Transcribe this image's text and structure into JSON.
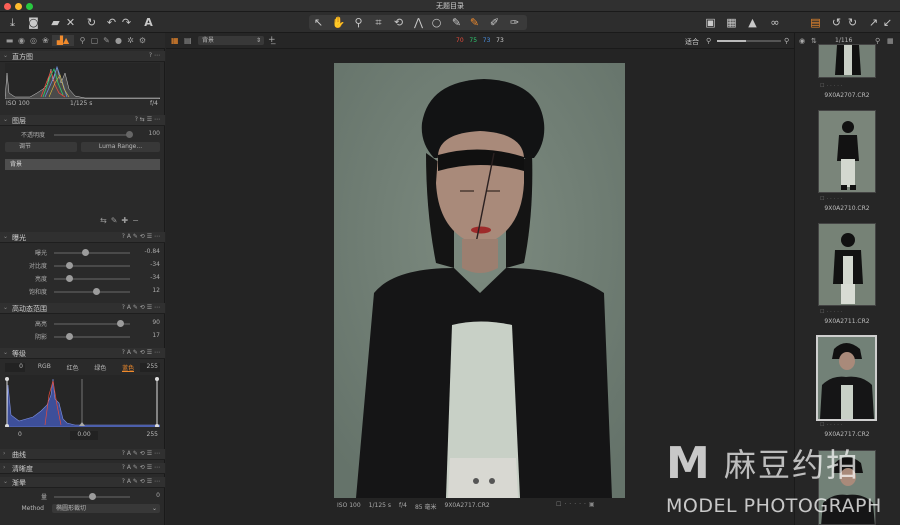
{
  "window": {
    "title": "无题目录"
  },
  "toolbar": {
    "left_icons": [
      "import-icon",
      "camera-icon",
      "export-icon",
      "delete-icon",
      "refresh-icon",
      "undo-icon",
      "redo-icon",
      "text-icon"
    ],
    "center_icons": [
      "select-tool-icon",
      "pan-tool-icon",
      "loupe-tool-icon",
      "crop-tool-icon",
      "rotate-tool-icon",
      "keystone-tool-icon",
      "spot-tool-icon",
      "brush-tool-icon",
      "brush-active-tool-icon",
      "eraser-tool-icon",
      "gradient-tool-icon"
    ],
    "right_icons": [
      "edit-icon",
      "grid-icon",
      "warning-icon",
      "glasses-icon",
      "copy-icon",
      "rotate-left-icon",
      "rotate-right-icon",
      "expand-icon",
      "collapse-icon"
    ]
  },
  "viewer_header": {
    "layer_select": "背景",
    "readout": [
      "70",
      "75",
      "73",
      "73"
    ],
    "readout_colors": [
      "#e74c3c",
      "#2ecc71",
      "#4a90e2",
      "#cfcfcf"
    ],
    "fit_label": "适合",
    "zoom_fraction": 0.45
  },
  "histogram": {
    "title": "直方图",
    "iso": "ISO 100",
    "shutter": "1/125 s",
    "aperture": "f/4"
  },
  "layers": {
    "title": "图层",
    "opacity_label": "不透明度",
    "opacity_value": "100",
    "adjust_button": "调节",
    "luma_button": "Luma Range...",
    "layer_name": "背景"
  },
  "exposure": {
    "title": "曝光",
    "rows": [
      {
        "label": "曝光",
        "value": "-0.84",
        "pos": 0.4
      },
      {
        "label": "对比度",
        "value": "-34",
        "pos": 0.17
      },
      {
        "label": "亮度",
        "value": "-34",
        "pos": 0.17
      },
      {
        "label": "饱和度",
        "value": "12",
        "pos": 0.56
      }
    ]
  },
  "hdr": {
    "title": "高动态范围",
    "rows": [
      {
        "label": "高亮",
        "value": "90",
        "pos": 0.9
      },
      {
        "label": "阴影",
        "value": "17",
        "pos": 0.17
      }
    ]
  },
  "levels": {
    "title": "等级",
    "left_value": "0",
    "right_value": "255",
    "channels": [
      "RGB",
      "红色",
      "绿色",
      "蓝色"
    ],
    "active_channel": "蓝色",
    "out_low": "0",
    "mid": "0.00",
    "out_high": "255"
  },
  "curves": {
    "title": "曲线"
  },
  "clarity": {
    "title": "清晰度"
  },
  "vignette": {
    "title": "渐晕",
    "amount_label": "量",
    "amount_value": "0",
    "amount_pos": 0.5,
    "method_label": "Method",
    "method_value": "椭圆形裁切"
  },
  "photo": {
    "caption": [
      "ISO 100",
      "1/125 s",
      "f/4",
      "85 毫米",
      "9X0A2717.CR2"
    ]
  },
  "filmstrip": {
    "counter": "1/116",
    "items": [
      {
        "name": "9X0A2707.CR2"
      },
      {
        "name": "9X0A2710.CR2"
      },
      {
        "name": "9X0A2711.CR2"
      },
      {
        "name": "9X0A2717.CR2",
        "selected": true
      },
      {
        "name": ""
      }
    ]
  },
  "watermark": {
    "cn": "麻豆约拍",
    "en": "MODEL PHOTOGRAPH",
    "letter": "M"
  }
}
